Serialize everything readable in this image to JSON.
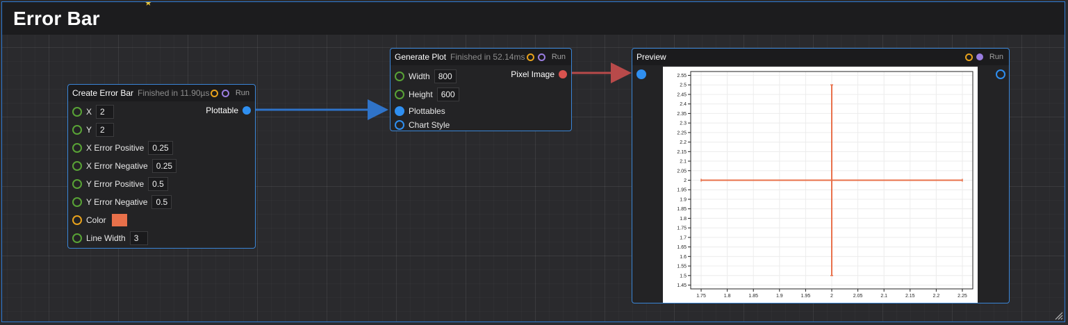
{
  "page": {
    "title": "Error Bar"
  },
  "nodes": {
    "create": {
      "title": "Create Error Bar",
      "status": "Finished in 11.90µs",
      "run": "Run",
      "output": "Plottable",
      "inputs": [
        {
          "label": "X",
          "value": "2"
        },
        {
          "label": "Y",
          "value": "2"
        },
        {
          "label": "X Error Positive",
          "value": "0.25"
        },
        {
          "label": "X Error Negative",
          "value": "0.25"
        },
        {
          "label": "Y Error Positive",
          "value": "0.5"
        },
        {
          "label": "Y Error Negative",
          "value": "0.5"
        },
        {
          "label": "Color",
          "value": "#e8704a"
        },
        {
          "label": "Line Width",
          "value": "3"
        }
      ]
    },
    "generate": {
      "title": "Generate Plot",
      "status": "Finished in 52.14ms",
      "run": "Run",
      "output": "Pixel Image",
      "inputs": [
        {
          "label": "Width",
          "value": "800"
        },
        {
          "label": "Height",
          "value": "600"
        },
        {
          "label": "Plottables"
        },
        {
          "label": "Chart Style"
        }
      ]
    },
    "preview": {
      "title": "Preview",
      "run": "Run"
    }
  },
  "colors": {
    "accent": "#2e7bd6",
    "errorbar": "#e8704a",
    "port_green": "#59a336",
    "port_orange": "#e8a21c",
    "port_blue": "#2f8ff0",
    "port_red": "#d9534f",
    "purple": "#9a7de0"
  },
  "chart_data": {
    "type": "scatter",
    "title": "",
    "xlabel": "",
    "ylabel": "",
    "xlim": [
      1.73,
      2.27
    ],
    "ylim": [
      1.43,
      2.57
    ],
    "xticks": [
      "1.75",
      "1.8",
      "1.85",
      "1.9",
      "1.95",
      "2",
      "2.05",
      "2.1",
      "2.15",
      "2.2",
      "2.25"
    ],
    "yticks": [
      "1.45",
      "1.5",
      "1.55",
      "1.6",
      "1.65",
      "1.7",
      "1.75",
      "1.8",
      "1.85",
      "1.9",
      "1.95",
      "2",
      "2.05",
      "2.1",
      "2.15",
      "2.2",
      "2.25",
      "2.3",
      "2.35",
      "2.4",
      "2.45",
      "2.5",
      "2.55"
    ],
    "grid": true,
    "error_bar": {
      "x": 2,
      "y": 2,
      "x_err_pos": 0.25,
      "x_err_neg": 0.25,
      "y_err_pos": 0.5,
      "y_err_neg": 0.5
    }
  }
}
